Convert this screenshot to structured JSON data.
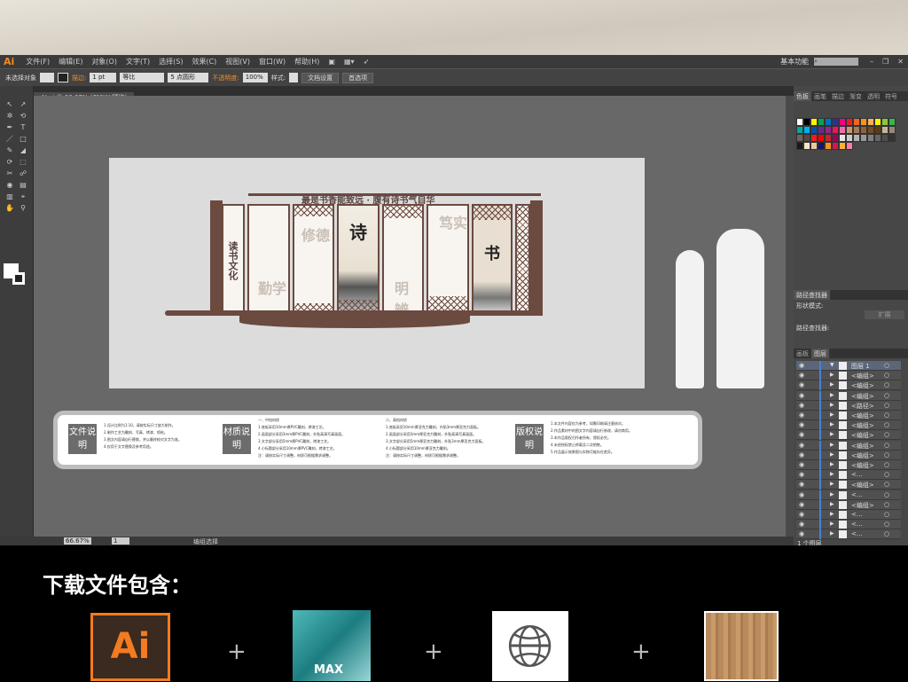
{
  "menubar": {
    "logo": "Ai",
    "items": [
      "文件(F)",
      "编辑(E)",
      "对象(O)",
      "文字(T)",
      "选择(S)",
      "效果(C)",
      "视图(V)",
      "窗口(W)",
      "帮助(H)"
    ],
    "workspace": "基本功能"
  },
  "control": {
    "selection": "未选择对象",
    "stroke_label": "描边:",
    "stroke_value": "1 pt",
    "profile": "等比",
    "brush": "5 点圆形",
    "opacity_label": "不透明度:",
    "opacity_value": "100%",
    "style_label": "样式:",
    "doc_setup": "文档设置",
    "prefs": "首选项"
  },
  "doc_tab": {
    "title": "AI.ai @ 66.67% (CMYK/预览)"
  },
  "artwork": {
    "title": "最是书香能致远 · 腹有诗书气自华",
    "panels": [
      "读书文化",
      "勤学",
      "修德",
      "诗",
      "明辨",
      "笃实",
      "书"
    ]
  },
  "info": {
    "sections": [
      {
        "head": "文件说明",
        "lines": [
          "1.设计比例为1:10，请按实际尺寸放大制作。",
          "2.制作工艺为雕刻、写真、烤漆、喷绘。",
          "3.图文内容请自行替换，并以最终校对文字为准。",
          "4.仅用于文字替换及参考用途。"
        ]
      },
      {
        "head": "材质说明",
        "lines": [
          "一、中档材质",
          "1.底板采用10mm厚PVC雕刻，烤漆工艺。",
          "2.画面部分采用3mm厚PVC雕刻，外贴高清写真画面。",
          "3.文字部分采用5mm厚PVC雕刻，烤漆工艺。",
          "4.小标题部分采用10mm厚PVC雕刻，烤漆工艺。",
          "注：请按实际尺寸调整，材质可根据需求调整。"
        ]
      },
      {
        "head": "",
        "lines": [
          "二、高档材质",
          "1.底板采用10mm厚亚克力雕刻，外贴3mm厚亚克力面板。",
          "2.画面部分采用3mm厚亚克力雕刻，外贴高清写真画面。",
          "3.文字部分采用5mm厚亚克力雕刻，外贴3mm厚亚克力面板。",
          "4.小标题部分采用10mm厚亚克力雕刻。",
          "注：请按实际尺寸调整，材质可根据需求调整。"
        ]
      },
      {
        "head": "版权说明",
        "lines": [
          "1.本文件内容仅为参考，如需印刷请注意核对。",
          "2.作品素材中的图文字内容请自行修改，请勿商用。",
          "3.本作品版权归作者所有，侵权必究。",
          "4.未经授权禁止转载及二次销售。",
          "5.作品展示效果图与实物可能存在差异。"
        ]
      }
    ]
  },
  "panels": {
    "swatch_tabs": [
      "色板",
      "画笔",
      "描边",
      "渐变",
      "透明",
      "符号"
    ],
    "swatch_colors": [
      "#ffffff",
      "#000000",
      "#fff200",
      "#00a651",
      "#0072bc",
      "#2e3192",
      "#ec008c",
      "#ed1c24",
      "#f26522",
      "#f7941d",
      "#fbaf5d",
      "#fff200",
      "#8dc63f",
      "#39b54a",
      "#00a99d",
      "#00aeef",
      "#0054a6",
      "#662d91",
      "#92278f",
      "#ed145b",
      "#f06eaa",
      "#c69c6d",
      "#a67c52",
      "#8c6239",
      "#754c24",
      "#603913",
      "#c2b59b",
      "#998675",
      "#736357",
      "#534741",
      "#ed1c24",
      "#ff0000",
      "#c1272d",
      "#9e005d",
      "#e5e5e5",
      "#cccccc",
      "#b3b3b3",
      "#999999",
      "#808080",
      "#666666",
      "#4d4d4d",
      "#333333",
      "#1a1a1a",
      "#f5e6c8",
      "#e7c9a0",
      "#1b1464",
      "#f7931e",
      "#d4145a",
      "#fbb03b",
      "#ff7bac"
    ],
    "pathfinder_tab": "路径查找器",
    "shape_modes": "形状模式:",
    "expand": "扩展",
    "pathfinders": "路径查找器:",
    "layer_tabs": [
      "画板",
      "图层"
    ],
    "layers": [
      "图层 1",
      "<编组>",
      "<编组>",
      "<编组>",
      "<路径>",
      "<编组>",
      "<编组>",
      "<编组>",
      "<编组>",
      "<编组>",
      "<编组>",
      "<...",
      "<编组>",
      "<...",
      "<编组>",
      "<...",
      "<...",
      "<..."
    ],
    "layer_count": "1 个图层"
  },
  "status": {
    "zoom": "66.67%",
    "page": "1",
    "mode": "编组选择"
  },
  "bottom": {
    "title": "下载文件包含：",
    "items": [
      "Ai",
      "MAX"
    ]
  }
}
